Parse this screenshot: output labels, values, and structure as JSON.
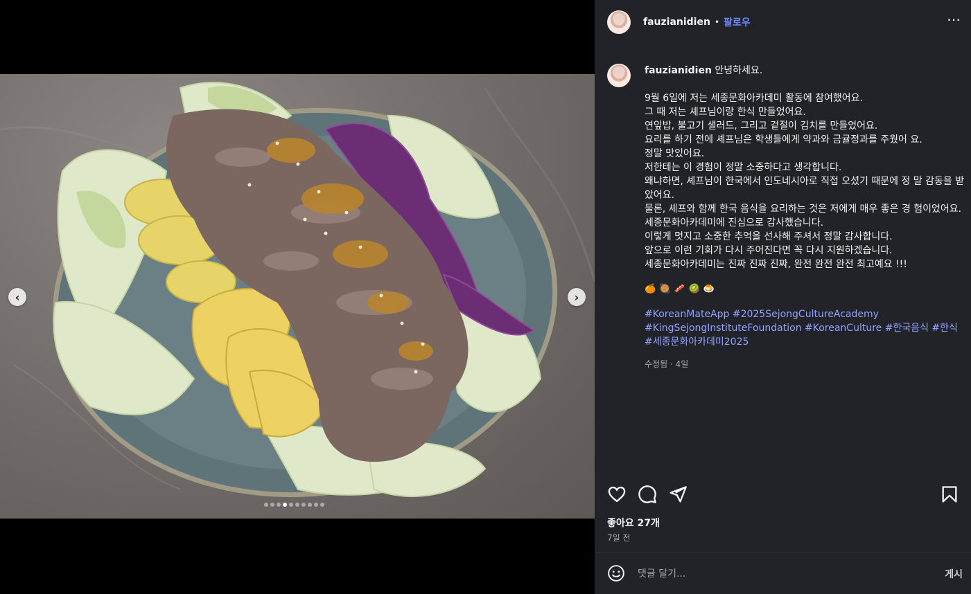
{
  "post": {
    "username": "fauzianidien",
    "separator": "•",
    "follow_label": "팔로우",
    "more_label": "•••"
  },
  "caption": {
    "greeting": "안녕하세요.",
    "lines": [
      "9월 6일에 저는 세종문화아카데미 활동에 참여했어요.",
      "그 때 저는 셰프님이랑 한식 만들었어요.",
      "연잎밥, 불고기 샐러드, 그리고 겉절이 김치를 만들었어요.",
      "요리를 하기 전에 셰프님은 학생들에게 약과와 금귤정과를 주웠어 요.",
      "정말 맛있어요.",
      "저한테는 이 경험이 정말 소중하다고 생각합니다.",
      "왜냐하면, 셰프님이 한국에서 인도네시아로 직접 오셨기 때문에 정 말 감동을 받았어요.",
      "물론, 셰프와 함께 한국 음식을 요리하는 것은 저에게 매우 좋은 경 험이었어요.",
      "세종문화아카데미에 진심으로 감사했습니다.",
      "이렇게 멋지고 소중한 추억을 선사해 주셔서 정말 감사합니다.",
      "앞으로 이런 기회가 다시 주어진다면 꼭 다시 지원하겠습니다.",
      "세종문화아카데미는 진짜 진짜 진짜, 완전 완전 완전 최고예요 !!!"
    ],
    "emojis": "🍊🥘🥓🥝🍮",
    "hashtags": "#KoreanMateApp #2025SejongCultureAcademy #KingSejongInstituteFoundation #KoreanCulture #한국음식 #한식 #세종문화아카데미2025",
    "edited_meta": "수정됨 · 4일"
  },
  "engagement": {
    "likes": "좋아요 27개",
    "posted": "7일 전"
  },
  "comment": {
    "placeholder": "댓글 달기...",
    "post_label": "게시"
  },
  "carousel": {
    "slide_count": 10,
    "active_index": 3
  },
  "icons": {
    "nav_prev": "chevron-left-icon",
    "nav_next": "chevron-right-icon",
    "like": "heart-icon",
    "comment": "comment-icon",
    "share": "paper-plane-icon",
    "save": "bookmark-icon",
    "emoji": "smile-icon"
  }
}
